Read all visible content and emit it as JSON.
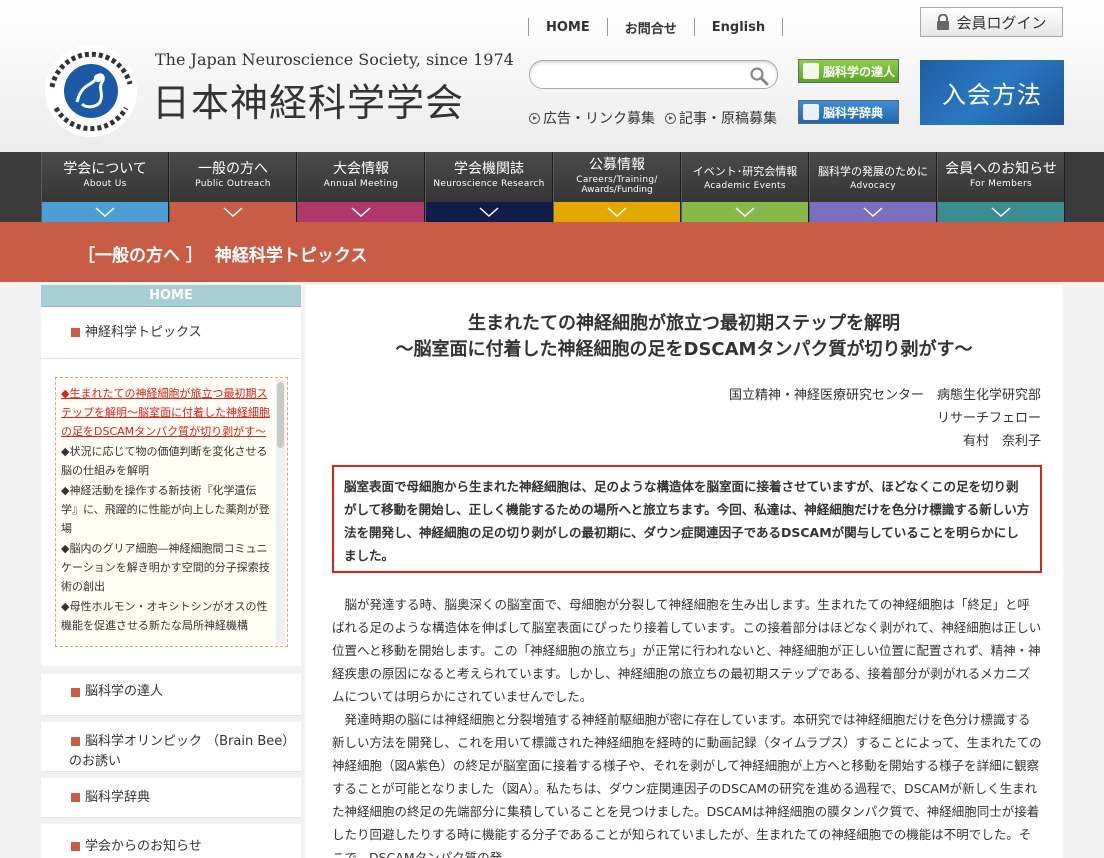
{
  "header": {
    "eng_name": "The Japan Neuroscience Society, since 1974",
    "jp_name": "日本神経科学学会",
    "topnav": [
      "HOME",
      "お問合せ",
      "English"
    ],
    "search_placeholder": "",
    "sublinks": [
      "広告・リンク募集",
      "記事・原稿募集"
    ],
    "btn_tatsujin": "脳科学の達人",
    "btn_jiten": "脳科学辞典",
    "login": "会員ログイン",
    "join": "入会方法"
  },
  "mainnav": [
    {
      "jp": "学会について",
      "en": "About Us",
      "color": "#4b9fd5"
    },
    {
      "jp": "一般の方へ",
      "en": "Public Outreach",
      "color": "#c95c45"
    },
    {
      "jp": "大会情報",
      "en": "Annual Meeting",
      "color": "#b1386b"
    },
    {
      "jp": "学会機関誌",
      "en": "Neuroscience Research",
      "color": "#101c4a"
    },
    {
      "jp": "公募情報",
      "en": "Careers/Training/",
      "en2": "Awards/Funding",
      "color": "#e2a800"
    },
    {
      "jp": "イベント･研究会情報",
      "en": "Academic Events",
      "color": "#86b84a"
    },
    {
      "jp": "脳科学の発展のために",
      "en": "Advocacy",
      "color": "#7a6fbf"
    },
    {
      "jp": "会員へのお知らせ",
      "en": "For Members",
      "color": "#3b8c8e"
    }
  ],
  "breadcrumb": {
    "section": "［一般の方へ ］",
    "page": "神経科学トピックス"
  },
  "sidebar": {
    "home": "HOME",
    "items_top": [
      "神経科学トピックス"
    ],
    "topics": [
      "◆生まれたての神経細胞が旅立つ最初期ステップを解明〜脳室面に付着した神経細胞の足をDSCAMタンパク質が切り剥がす〜",
      "◆状況に応じて物の価値判断を変化させる脳の仕組みを解明",
      "◆神経活動を操作する新技術『化学遺伝学』に、飛躍的に性能が向上した薬剤が登場",
      "◆脳内のグリア細胞―神経細胞間コミュニケーションを解き明かす空間的分子探索技術の創出",
      "◆母性ホルモン・オキシトシンがオスの性機能を促進させる新たな局所神経機構"
    ],
    "items_bottom": [
      "脳科学の達人",
      "脳科学オリンピック （Brain Bee）のお誘い",
      "脳科学辞典",
      "学会からのお知らせ"
    ]
  },
  "article": {
    "title_line1": "生まれたての神経細胞が旅立つ最初期ステップを解明",
    "title_line2": "〜脳室面に付着した神経細胞の足をDSCAMタンパク質が切り剥がす〜",
    "author_line1": "国立精神・神経医療研究センター　病態生化学研究部",
    "author_line2": "リサーチフェロー",
    "author_line3": "有村　奈利子",
    "summary": "脳室表面で母細胞から生まれた神経細胞は、足のような構造体を脳室面に接着させていますが、ほどなくこの足を切り剥がして移動を開始し、正しく機能するための場所へと旅立ちます。今回、私達は、神経細胞だけを色分け標識する新しい方法を開発し、神経細胞の足の切り剥がしの最初期に、ダウン症関連因子であるDSCAMが関与していることを明らかにしました。",
    "para1": "脳が発達する時、脳奥深くの脳室面で、母細胞が分裂して神経細胞を生み出します。生まれたての神経細胞は「終足」と呼ばれる足のような構造体を伸ばして脳室表面にぴったり接着しています。この接着部分はほどなく剥がれて、神経細胞は正しい位置へと移動を開始します。この「神経細胞の旅立ち」が正常に行われないと、神経細胞が正しい位置に配置されず、精神・神経疾患の原因になると考えられています。しかし、神経細胞の旅立ちの最初期ステップである、接着部分が剥がれるメカニズムについては明らかにされていませんでした。",
    "para2": "発達時期の脳には神経細胞と分裂増殖する神経前駆細胞が密に存在しています。本研究では神経細胞だけを色分け標識する新しい方法を開発し、これを用いて標識された神経細胞を経時的に動画記録（タイムラプス）することによって、生まれたての神経細胞（図A紫色）の終足が脳室面に接着する様子や、それを剥がして神経細胞が上方へと移動を開始する様子を詳細に観察することが可能となりました（図A）。私たちは、ダウン症関連因子のDSCAMの研究を進める過程で、DSCAMが新しく生まれた神経細胞の終足の先端部分に集積していることを見つけました。DSCAMは神経細胞の膜タンパク質で、神経細胞同士が接着したり回避したりする時に機能する分子であることが知られていましたが、生まれたての神経細胞での機能は不明でした。そこで、DSCAMタンパク質の発"
  }
}
